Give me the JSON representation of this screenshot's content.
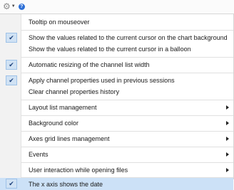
{
  "toolbar": {
    "gear_icon": "gear-icon",
    "help_icon": "help-icon",
    "help_glyph": "?"
  },
  "menu": {
    "items": [
      {
        "label": "Tooltip on mouseover",
        "checked": false,
        "submenu": false
      },
      {
        "label": "Show the values related to the current cursor on the chart background",
        "checked": true,
        "submenu": false
      },
      {
        "label": "Show the values related to the current cursor in a balloon",
        "checked": false,
        "submenu": false
      },
      {
        "label": "Automatic resizing of the channel list width",
        "checked": true,
        "submenu": false
      },
      {
        "label": "Apply channel properties used in previous sessions",
        "checked": true,
        "submenu": false
      },
      {
        "label": "Clear channel properties history",
        "checked": false,
        "submenu": false
      },
      {
        "label": "Layout list management",
        "checked": false,
        "submenu": true
      },
      {
        "label": "Background color",
        "checked": false,
        "submenu": true
      },
      {
        "label": "Axes grid lines management",
        "checked": false,
        "submenu": true
      },
      {
        "label": "Events",
        "checked": false,
        "submenu": true
      },
      {
        "label": "User interaction while opening files",
        "checked": false,
        "submenu": true
      },
      {
        "label": "The x axis shows the date",
        "checked": true,
        "submenu": false,
        "highlighted": true
      }
    ]
  }
}
